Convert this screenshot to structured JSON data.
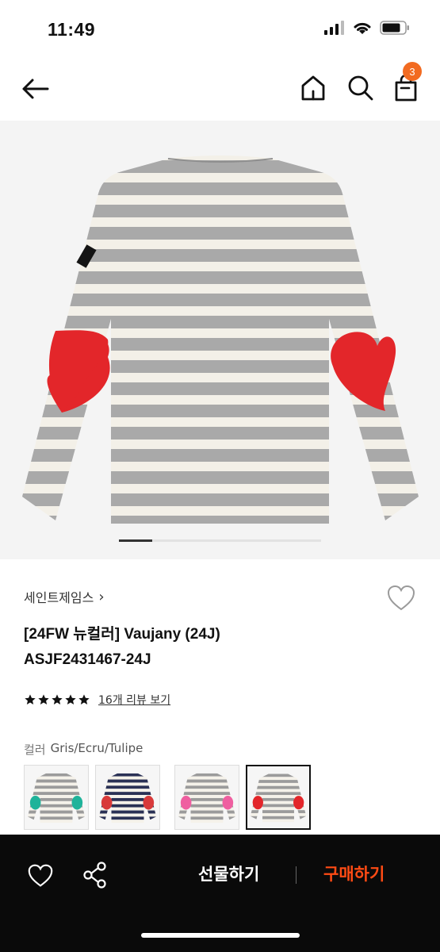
{
  "status": {
    "time": "11:49"
  },
  "nav": {
    "cart_count": "3"
  },
  "gallery": {
    "current_index": 1,
    "total": 6
  },
  "product": {
    "brand": "세인트제임스",
    "brand_chevron": "›",
    "title_line1": "[24FW 뉴컬러] Vaujany (24J)",
    "title_line2": "ASJF2431467-24J",
    "rating_stars": 5,
    "review_link": "16개 리뷰 보기"
  },
  "color": {
    "label": "컬러",
    "value": "Gris/Ecru/Tulipe",
    "options": [
      {
        "stripe": "#9b9b9b",
        "patch": "#1fb39a"
      },
      {
        "stripe": "#2a3155",
        "patch": "#d83a3a"
      },
      {
        "stripe": "#9b9b9b",
        "patch": "#ef5fa0"
      },
      {
        "stripe": "#9b9b9b",
        "patch": "#e3262a",
        "selected": true
      }
    ]
  },
  "bottom": {
    "gift_label": "선물하기",
    "buy_label": "구매하기"
  },
  "colors": {
    "accent": "#ff4b14",
    "badge": "#f26b21",
    "heart_patch": "#e3262a"
  }
}
